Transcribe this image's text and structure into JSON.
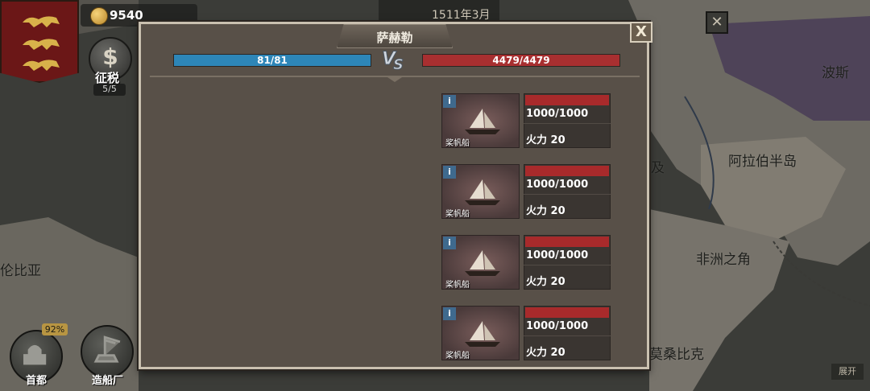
{
  "hud": {
    "gold": "9540",
    "tax_label": "征税",
    "tax_count": "5/5",
    "date": "1511年3月"
  },
  "map": {
    "labels": {
      "persia": "波斯",
      "arabia": "阿拉伯半岛",
      "horn_of_africa": "非洲之角",
      "colombia_partial": "伦比亚",
      "mozambique": "莫桑比克",
      "egypt_partial": "及"
    },
    "expand_label": "展开"
  },
  "bottom_nav": {
    "capital_label": "首都",
    "capital_percent": "92%",
    "shipyard_label": "造船厂"
  },
  "battle": {
    "title": "萨赫勒",
    "player_hp": "81/81",
    "enemy_hp": "4479/4479",
    "vs_text": "VS",
    "close_label": "X",
    "enemy_ships": [
      {
        "name": "桨帆船",
        "hp": "1000/1000",
        "firepower": "火力 20"
      },
      {
        "name": "桨帆船",
        "hp": "1000/1000",
        "firepower": "火力 20"
      },
      {
        "name": "桨帆船",
        "hp": "1000/1000",
        "firepower": "火力 20"
      },
      {
        "name": "桨帆船",
        "hp": "1000/1000",
        "firepower": "火力 20"
      }
    ]
  },
  "colors": {
    "player_bar": "#2d86b8",
    "enemy_bar": "#a82f30",
    "panel_bg": "#585048",
    "banner_red": "#6b1717"
  }
}
